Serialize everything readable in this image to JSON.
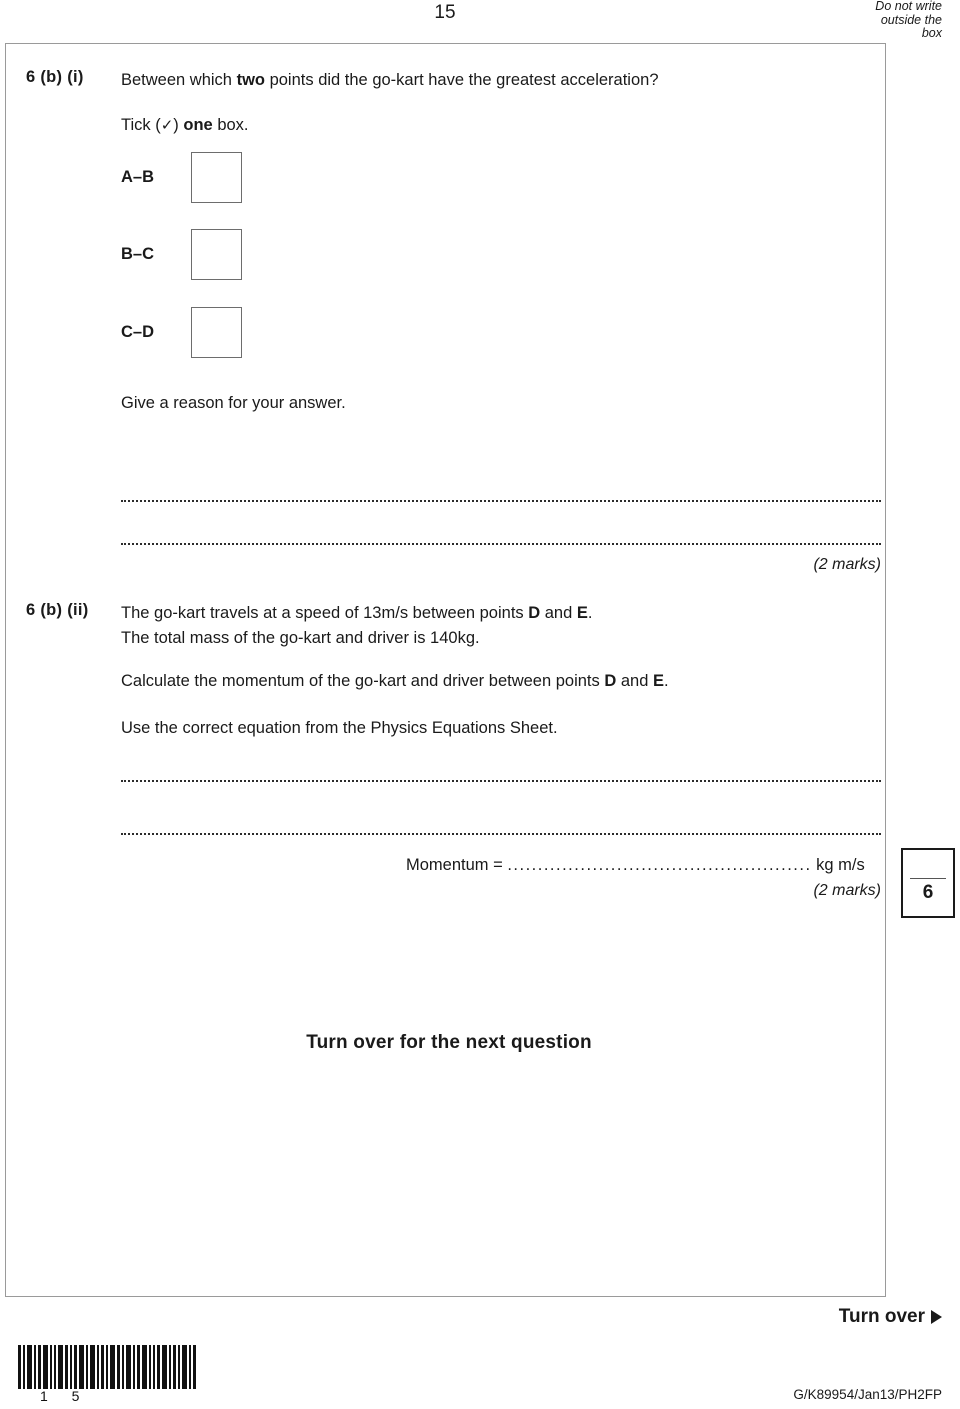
{
  "header": {
    "page_number": "15",
    "notice": "Do not write\noutside the\nbox",
    "notice_line_1": "Do not write",
    "notice_line_2": "outside the",
    "notice_line_3": "box"
  },
  "questions": [
    {
      "id": "6bi",
      "label": "6 (b) (i)",
      "prompt_pre": "Between which ",
      "prompt_bold": "two",
      "prompt_post": " points did the go-kart have the greatest acceleration?",
      "tick_pre": "Tick (",
      "tick_glyph": "✓",
      "tick_mid": ") ",
      "tick_bold": "one",
      "tick_post": " box.",
      "options": [
        {
          "label": "A–B"
        },
        {
          "label": "B–C"
        },
        {
          "label": "C–D"
        }
      ],
      "reason_prompt": "Give a reason for your answer.",
      "marks": "(2 marks)"
    },
    {
      "id": "6bii",
      "label": "6 (b) (ii)",
      "line_1_pre": "The go-kart travels at a speed of 13",
      "line_1_unit": "m/s",
      "line_1_mid": " between points ",
      "line_1_bold_1": "D",
      "line_1_and": " and ",
      "line_1_bold_2": "E",
      "line_1_end": ".",
      "line_2_pre": "The total mass of the go-kart and driver is 140",
      "line_2_unit": "kg",
      "line_2_end": ".",
      "calc_pre": "Calculate the momentum of the go-kart and driver between points ",
      "calc_bold_1": "D",
      "calc_and": " and ",
      "calc_bold_2": "E",
      "calc_end": ".",
      "equation_note": "Use the correct equation from the Physics Equations Sheet.",
      "answer_label": "Momentum =",
      "answer_dots": "..................................................",
      "answer_unit": "kg m/s",
      "marks": "(2 marks)"
    }
  ],
  "mark_total": {
    "value": "6"
  },
  "turn_next_question": "Turn over for the next question",
  "footer": {
    "turn_over": "Turn over",
    "arrow_icon": "triangle-right-icon",
    "barcode_icon": "barcode",
    "barcode_digits": "1  5",
    "doc_reference": "G/K89954/Jan13/PH2FP"
  },
  "colors": {
    "text": "#1a1a1a",
    "box_border": "#9a9a9a",
    "checkbox_border": "#6d6d6d",
    "mark_box_border": "#1a1a1a"
  }
}
